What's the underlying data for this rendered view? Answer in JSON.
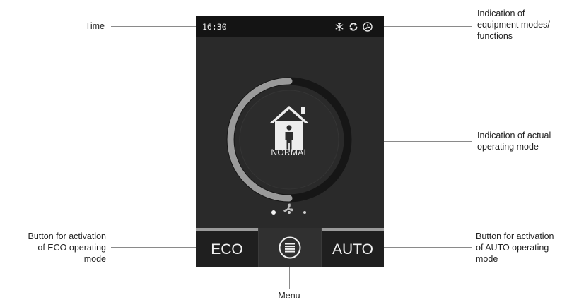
{
  "screen": {
    "time": "16:30",
    "mode_label": "NORMAL",
    "page_dots": {
      "count": 3,
      "active": 1
    },
    "level": 0.5,
    "buttons": {
      "eco_label": "ECO",
      "auto_label": "AUTO"
    },
    "status_icons": [
      "snowflake-icon",
      "recirculation-icon",
      "fan-icon"
    ]
  },
  "callouts": {
    "time": "Time",
    "indication_modes_line1": "Indication of",
    "indication_modes_line2": "equipment modes/",
    "indication_modes_line3": "functions",
    "actual_mode_line1": "Indication of actual",
    "actual_mode_line2": "operating mode",
    "eco_button_line1": "Button for activation",
    "eco_button_line2": "of ECO operating",
    "eco_button_line3": "mode",
    "auto_button_line1": "Button for activation",
    "auto_button_line2": "of AUTO operating",
    "auto_button_line3": "mode",
    "menu": "Menu"
  },
  "colors": {
    "screen_bg": "#2a2a2a",
    "topbar_bg": "#141414",
    "dial_track": "#161616",
    "dial_progress": "#9a9a9a",
    "dial_face": "#2c2c2c",
    "accent_strip": "#9a9a9a"
  }
}
